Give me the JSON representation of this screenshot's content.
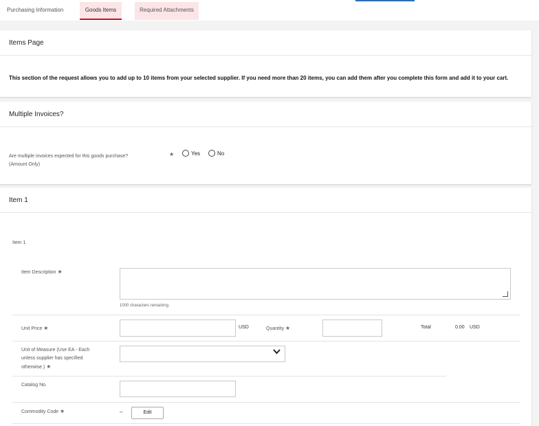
{
  "tabs": [
    {
      "label": "Purchasing Information"
    },
    {
      "label": "Goods Items"
    },
    {
      "label": "Required Attachments"
    }
  ],
  "items_page": {
    "title": "Items Page",
    "note": "This section of the request allows you to add up to 10 items from your selected supplier. If you need more than 20 items, you can add them after you complete this form and add it to your cart."
  },
  "multiple_invoices": {
    "title": "Multiple Invoices?",
    "question_line1": "Are multiple invoices expected for this goods purchase?",
    "question_line2": "(Amount Only)",
    "required_mark": "★",
    "options": [
      "Yes",
      "No"
    ]
  },
  "item1": {
    "title": "Item 1",
    "subtitle": "Item 1",
    "item_description_label": "Item Description",
    "item_description_value": "",
    "chars_remaining": "1000 characters remaining",
    "unit_price_label": "Unit Price",
    "unit_price_value": "",
    "currency": "USD",
    "quantity_label": "Quantity",
    "quantity_value": "",
    "total_label": "Total",
    "total_value": "0.00",
    "total_currency": "USD",
    "uom_label_line1": "Unit of Measure (Use EA - Each",
    "uom_label_line2": "unless supplier has specified",
    "uom_label_line3": "otherwise.)",
    "uom_value": "",
    "catalog_label": "Catalog No.",
    "catalog_value": "",
    "commodity_label": "Commodity Code",
    "commodity_value": "–",
    "edit_label": "Edit",
    "required_mark": "★"
  }
}
